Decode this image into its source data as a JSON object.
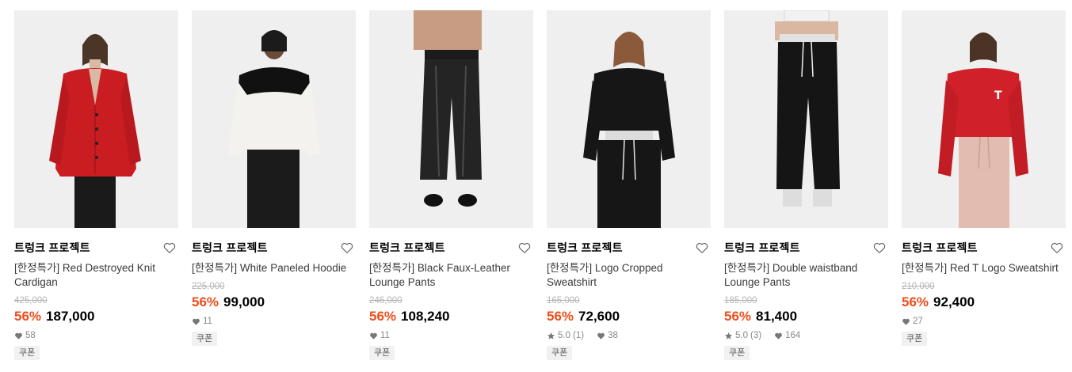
{
  "products": [
    {
      "brand": "트렁크 프로젝트",
      "title": "[한정특가] Red Destroyed Knit Cardigan",
      "original_price": "425,000",
      "discount": "56%",
      "price": "187,000",
      "rating": "",
      "reviews": "",
      "likes": "58",
      "badge": "쿠폰"
    },
    {
      "brand": "트렁크 프로젝트",
      "title": "[한정특가] White Paneled Hoodie",
      "original_price": "225,000",
      "discount": "56%",
      "price": "99,000",
      "rating": "",
      "reviews": "",
      "likes": "11",
      "badge": "쿠폰"
    },
    {
      "brand": "트렁크 프로젝트",
      "title": "[한정특가] Black Faux-Leather Lounge Pants",
      "original_price": "246,000",
      "discount": "56%",
      "price": "108,240",
      "rating": "",
      "reviews": "",
      "likes": "11",
      "badge": "쿠폰"
    },
    {
      "brand": "트렁크 프로젝트",
      "title": "[한정특가] Logo Cropped Sweatshirt",
      "original_price": "165,000",
      "discount": "56%",
      "price": "72,600",
      "rating": "5.0",
      "reviews": "(1)",
      "likes": "38",
      "badge": "쿠폰"
    },
    {
      "brand": "트렁크 프로젝트",
      "title": "[한정특가] Double waistband Lounge Pants",
      "original_price": "185,000",
      "discount": "56%",
      "price": "81,400",
      "rating": "5.0",
      "reviews": "(3)",
      "likes": "164",
      "badge": "쿠폰"
    },
    {
      "brand": "트렁크 프로젝트",
      "title": "[한정특가] Red T Logo Sweatshirt",
      "original_price": "210,000",
      "discount": "56%",
      "price": "92,400",
      "rating": "",
      "reviews": "",
      "likes": "27",
      "badge": "쿠폰"
    }
  ],
  "colors": {
    "discount": "#ef4d1a",
    "image_bg": "#efefef",
    "badge_bg": "#f1f1f1",
    "original_price": "#b5b5b5"
  },
  "icons": {
    "wishlist": "heart-outline-icon",
    "likes": "heart-filled-icon",
    "rating": "star-icon"
  }
}
